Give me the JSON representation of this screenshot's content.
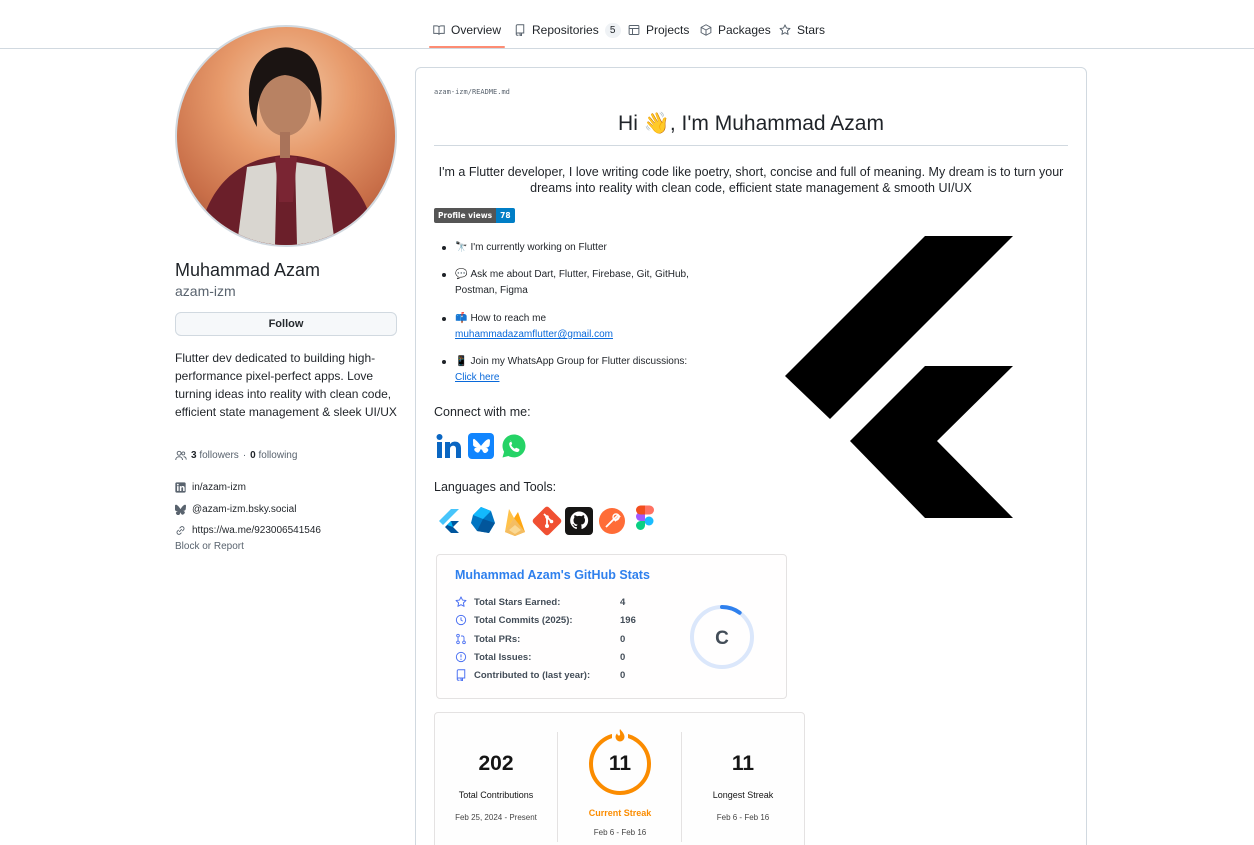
{
  "nav": {
    "tabs": [
      {
        "label": "Overview",
        "icon": "book-icon",
        "active": true
      },
      {
        "label": "Repositories",
        "icon": "repo-icon",
        "count": "5"
      },
      {
        "label": "Projects",
        "icon": "table-icon"
      },
      {
        "label": "Packages",
        "icon": "package-icon"
      },
      {
        "label": "Stars",
        "icon": "star-icon"
      }
    ]
  },
  "profile": {
    "name": "Muhammad Azam",
    "login": "azam-izm",
    "follow_label": "Follow",
    "bio": "Flutter dev dedicated to building high-performance pixel-perfect apps. Love turning ideas into reality with clean code, efficient state management & sleek UI/UX",
    "followers_count": "3",
    "followers_label": "followers",
    "separator": "·",
    "following_count": "0",
    "following_label": "following",
    "links": [
      {
        "icon": "linkedin-icon",
        "text": "in/azam-izm"
      },
      {
        "icon": "bluesky-icon",
        "text": "@azam-izm.bsky.social"
      },
      {
        "icon": "link-icon",
        "text": "https://wa.me/923006541546"
      }
    ],
    "block_report": "Block or Report"
  },
  "readme": {
    "path_owner": "azam-izm",
    "path_sep": "/",
    "path_file": "README.md",
    "title_prefix": "Hi ",
    "title_wave": "👋",
    "title_suffix": ", I'm Muhammad Azam",
    "intro": "I'm a Flutter developer, I love writing code like poetry, short, concise and full of meaning. My dream is to turn your dreams into reality with clean code, efficient state management & smooth UI/UX",
    "badge": {
      "label": "Profile views",
      "value": "78"
    },
    "bullets": [
      {
        "emoji": "🔭",
        "text": "I'm currently working on ",
        "strong": "Flutter"
      },
      {
        "emoji": "💬",
        "text": "Ask me about Dart, Flutter, Firebase, Git, GitHub, Postman, Figma"
      },
      {
        "emoji": "📫",
        "text": "How to reach me",
        "link": "muhammadazamflutter@gmail.com"
      },
      {
        "emoji": "📱",
        "text": "Join my WhatsApp Group for Flutter discussions:",
        "link": "Click here"
      }
    ],
    "connect_heading": "Connect with me:",
    "social_icons": [
      "linkedin-icon",
      "bluesky-icon",
      "whatsapp-icon"
    ],
    "tools_heading": "Languages and Tools:",
    "tool_icons": [
      "flutter-icon",
      "dart-icon",
      "firebase-icon",
      "git-icon",
      "github-icon",
      "postman-icon",
      "figma-icon"
    ],
    "colors": {
      "flutter": "#02569b",
      "dart": "#0175c2",
      "firebase": "#ffca28",
      "git": "#f05032",
      "postman": "#ff6c37",
      "link": "#0969da",
      "stats_title": "#2f80ed",
      "streak_accent": "#fb8c00"
    }
  },
  "stats": {
    "title": "Muhammad Azam's GitHub Stats",
    "rows": [
      {
        "icon": "star-icon",
        "label": "Total Stars Earned:",
        "value": "4"
      },
      {
        "icon": "history-icon",
        "label": "Total Commits (2025):",
        "value": "196"
      },
      {
        "icon": "pull-request-icon",
        "label": "Total PRs:",
        "value": "0"
      },
      {
        "icon": "issue-icon",
        "label": "Total Issues:",
        "value": "0"
      },
      {
        "icon": "repo-icon",
        "label": "Contributed to (last year):",
        "value": "0"
      }
    ],
    "rank": "C",
    "rank_progress": 0.1
  },
  "streak": {
    "total": {
      "value": "202",
      "label": "Total Contributions",
      "range": "Feb 25, 2024 - Present"
    },
    "current": {
      "value": "11",
      "label": "Current Streak",
      "range": "Feb 6 - Feb 16"
    },
    "longest": {
      "value": "11",
      "label": "Longest Streak",
      "range": "Feb 6 - Feb 16"
    }
  }
}
